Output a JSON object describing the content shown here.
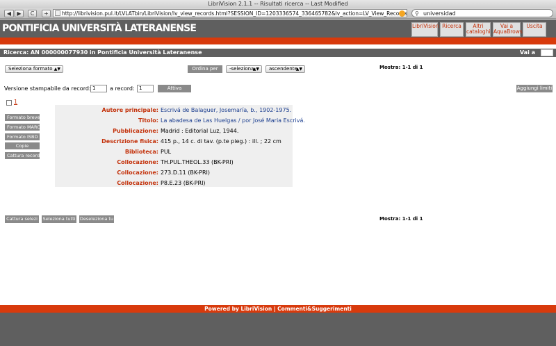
{
  "browser": {
    "window_title": "LibriVision 2.1.1 -- Risultati ricerca -- Last Modified",
    "url": "http://librivision.pul.it/LVLATbin/LibriVision/lv_view_records.html?SESSION_ID=1203336574_336465782&lv_action=LV_View_Records&NR_RECOI",
    "search_value": "universidad",
    "back": "◀",
    "forward": "▶",
    "reload": "C",
    "add": "+"
  },
  "header": {
    "site_title": "PONTIFICIA UNIVERSITÀ LATERANENSE",
    "nav": [
      "LibriVision",
      "Ricerca",
      "Altri cataloghi",
      "Vai a AquaBrowser",
      "Uscita"
    ]
  },
  "infobar": {
    "ricerca_label": "Ricerca:",
    "ricerca_value": "AN 000000077930",
    "ricerca_suffix": "in Pontificia Università Lateranense",
    "vaia_label": "Vai a"
  },
  "controls": {
    "format_select": "Seleziona formato",
    "order_button": "Ordina per",
    "order_select": "-seleziona-",
    "direction_select": "ascendente",
    "mostra_top": "Mostra: 1-1 di 1",
    "print_label": "Versione stampabile da record:",
    "print_from": "1",
    "print_to_label": "a record:",
    "print_to": "1",
    "attiva_button": "Attiva",
    "limits_button": "Aggiungi limiti"
  },
  "record": {
    "number": "1",
    "side_buttons": [
      "Formato breve",
      "Formato MARC",
      "Formato ISBD",
      "Copie",
      "Cattura record"
    ],
    "fields": [
      {
        "label": "Autore principale:",
        "value": "Escrivá de Balaguer, Josemaría, b., 1902-1975."
      },
      {
        "label": "Titolo:",
        "value": "La abadesa de Las Huelgas / por José Maria Escrivá."
      },
      {
        "label": "Pubblicazione:",
        "value": "Madrid : Editorial Luz, 1944."
      },
      {
        "label": "Descrizione fisica:",
        "value": "415 p., 14 c. di tav. (p.te pieg.) : ill. ; 22 cm"
      },
      {
        "label": "Biblioteca:",
        "value": "PUL"
      },
      {
        "label": "Collocazione:",
        "value": "TH.PUL.THEOL.33 (BK-PRI)"
      },
      {
        "label": "Collocazione:",
        "value": "273.D.11 (BK-PRI)"
      },
      {
        "label": "Collocazione:",
        "value": "P8.E.23 (BK-PRI)"
      }
    ]
  },
  "bottom": {
    "buttons": [
      "Cattura selezi",
      "Seleziona tutti",
      "Deseleziona tu"
    ],
    "mostra_bottom": "Mostra: 1-1 di 1"
  },
  "footer": {
    "text": "Powered by LibriVision | Commenti&Suggerimenti"
  },
  "colors": {
    "accent_orange": "#d83a0c",
    "header_gray": "#5f5f5f",
    "label_red": "#c3310a",
    "link_blue": "#1a3d8f"
  }
}
